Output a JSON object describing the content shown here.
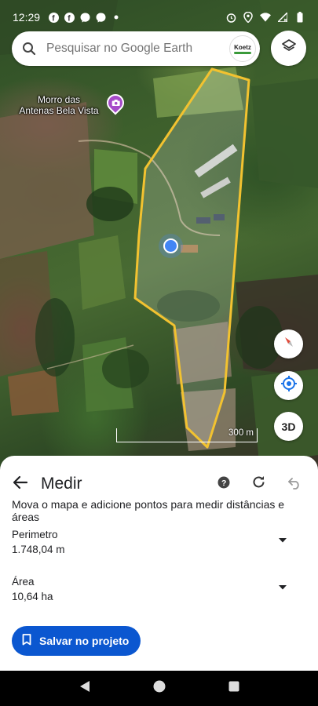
{
  "status_bar": {
    "time": "12:29",
    "left_icons": [
      "facebook-icon",
      "facebook-icon",
      "messenger-icon",
      "messenger-icon",
      "dot-icon"
    ],
    "right_icons": [
      "alarm-icon",
      "location-icon",
      "wifi-icon",
      "signal-icon",
      "battery-icon"
    ]
  },
  "search": {
    "placeholder": "Pesquisar no Google Earth",
    "brand_logo_text": "Koetz"
  },
  "map": {
    "poi_label": "Morro das\nAntenas Bela Vista",
    "scale_label": "300 m",
    "three_d_label": "3D",
    "polygon_color": "#f2c230",
    "location_color": "#4285f4"
  },
  "sheet": {
    "title": "Medir",
    "instruction": "Mova o mapa e adicione pontos para medir distâncias e áreas",
    "perimeter_label": "Perimetro",
    "perimeter_value": "1.748,04 m",
    "area_label": "Área",
    "area_value": "10,64 ha",
    "save_button": "Salvar no projeto"
  },
  "colors": {
    "accent": "#0b57d0"
  }
}
